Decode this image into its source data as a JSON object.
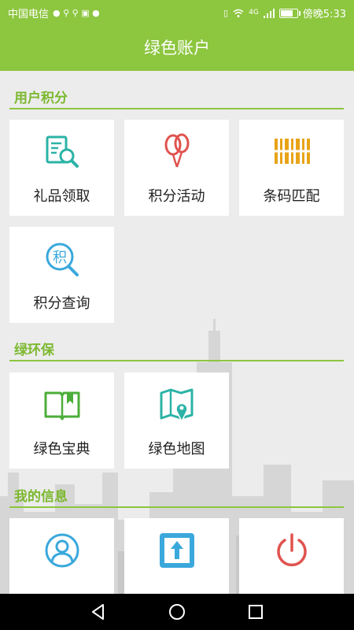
{
  "status_bar": {
    "carrier": "中国电信",
    "time_label": "傍晚5:33",
    "network": "4G",
    "battery_level": 0.85
  },
  "header": {
    "title": "绿色账户"
  },
  "sections": [
    {
      "title": "用户积分",
      "tiles": [
        {
          "label": "礼品领取",
          "icon": "document-search-icon",
          "color": "#2bb3a6"
        },
        {
          "label": "积分活动",
          "icon": "balloon-icon",
          "color": "#e0534f"
        },
        {
          "label": "条码匹配",
          "icon": "barcode-icon",
          "color": "#e8a317"
        },
        {
          "label": "积分查询",
          "icon": "points-search-icon",
          "color": "#3aa8dc"
        }
      ]
    },
    {
      "title": "绿环保",
      "tiles": [
        {
          "label": "绿色宝典",
          "icon": "book-icon",
          "color": "#4cae3a"
        },
        {
          "label": "绿色地图",
          "icon": "map-pin-icon",
          "color": "#2bb3a6"
        }
      ]
    },
    {
      "title": "我的信息",
      "tiles": [
        {
          "label": "",
          "icon": "user-profile-icon",
          "color": "#3aa8dc"
        },
        {
          "label": "",
          "icon": "upload-icon",
          "color": "#3aa8dc"
        },
        {
          "label": "",
          "icon": "power-icon",
          "color": "#e0534f"
        }
      ]
    }
  ],
  "points_icon_char": "积",
  "nav": {
    "back": "back-icon",
    "home": "home-icon",
    "recents": "recents-icon"
  }
}
